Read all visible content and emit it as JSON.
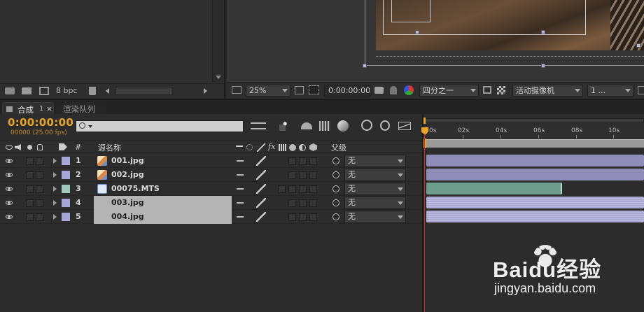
{
  "project_panel": {
    "bpc_label": "8 bpc"
  },
  "viewer": {
    "zoom": "25%",
    "timecode": "0:00:00:00",
    "resolution": "四分之一",
    "camera": "活动摄像机",
    "view_count": "1 ..."
  },
  "tabs": [
    {
      "label": "合成",
      "sub": "1",
      "close": "×"
    },
    {
      "label": "渲染队列"
    }
  ],
  "timeline": {
    "current_time": "0:00:00:00",
    "frame_info": "00000 (25.00 fps)",
    "search_placeholder": "",
    "search_icon": "magnifier-dropdown",
    "col_hash": "#",
    "col_source": "源名称",
    "col_parent": "父级",
    "switch_fx": "fx",
    "ruler": [
      "0s",
      "02s",
      "04s",
      "06s",
      "08s",
      "10s"
    ],
    "layers": [
      {
        "index": "1",
        "name": "001.jpg",
        "parent": "无",
        "label_color": "#a8a6d6",
        "icon": "image-file-icon",
        "selected": false,
        "bar_color": "#8f8cb8"
      },
      {
        "index": "2",
        "name": "002.jpg",
        "parent": "无",
        "label_color": "#a8a6d6",
        "icon": "image-file-icon",
        "selected": false,
        "bar_color": "#8f8cb8"
      },
      {
        "index": "3",
        "name": "00075.MTS",
        "parent": "无",
        "label_color": "#9ec8bc",
        "icon": "video-file-icon",
        "selected": false,
        "bar_color": "#6e9c8d"
      },
      {
        "index": "4",
        "name": "003.jpg",
        "parent": "无",
        "label_color": "#a8a6d6",
        "icon": "image-file-icon",
        "selected": true,
        "bar_color": "#a9a7cf"
      },
      {
        "index": "5",
        "name": "004.jpg",
        "parent": "无",
        "label_color": "#a8a6d6",
        "icon": "image-file-icon",
        "selected": true,
        "bar_color": "#a9a7cf"
      }
    ]
  },
  "watermark": {
    "brand": "Baidu经验",
    "url": "jingyan.baidu.com"
  },
  "colors": {
    "timecode": "#e7a42a",
    "playhead": "#d8202a",
    "work_area": "#9a9a9a"
  }
}
